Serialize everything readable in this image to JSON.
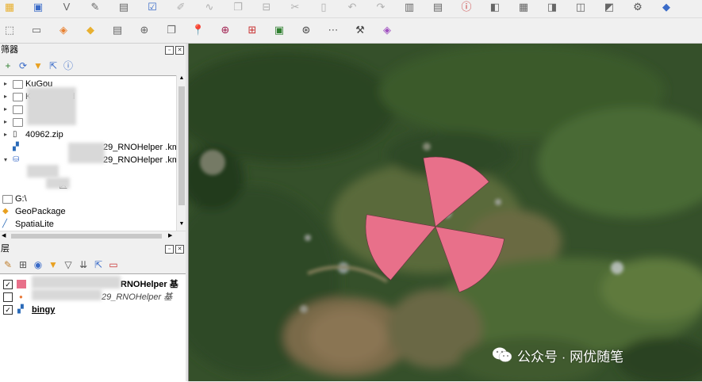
{
  "toolbar_top": {
    "icons": [
      "new-layer-icon",
      "save-icon",
      "vertex-icon",
      "digitize-icon",
      "edit-icon",
      "select-icon",
      "pencil-icon",
      "curve-icon",
      "copy-icon",
      "label-icon",
      "cut-icon",
      "paste-icon",
      "undo-icon",
      "redo-icon",
      "attribute-icon",
      "field-calc-icon",
      "identify-icon",
      "measure-icon",
      "statistics-icon",
      "tip-icon",
      "map-tips-icon",
      "hide-icon",
      "plugin-icon",
      "python-icon"
    ]
  },
  "toolbar_second": {
    "icons": [
      "select-feature-icon",
      "deselect-icon",
      "select-value-icon",
      "select-location-icon",
      "attribute-table-icon",
      "locate-icon",
      "copy-feature-icon",
      "pin-icon",
      "zoom-in-icon",
      "zoom-selection-icon",
      "zoom-layer-icon",
      "globe-icon",
      "xy-icon",
      "wrench-icon",
      "plugin-cube-icon"
    ]
  },
  "browser_panel": {
    "title": "筛器",
    "tools": [
      "add-icon",
      "refresh-icon",
      "filter-icon",
      "collapse-icon",
      "info-icon"
    ],
    "items": [
      {
        "label": "KuGou",
        "type": "folder",
        "expandable": true
      },
      {
        "label": "KuDownload",
        "type": "folder",
        "expandable": true
      },
      {
        "label": "",
        "type": "folder",
        "expandable": true
      },
      {
        "label": "",
        "type": "folder",
        "expandable": true
      },
      {
        "label": "40962.zip",
        "type": "zip",
        "expandable": true
      },
      {
        "label": "29_RNOHelper .km",
        "type": "kml",
        "expandable": false
      },
      {
        "label": "29_RNOHelper .km",
        "type": "db",
        "expandable": true
      },
      {
        "label": "",
        "type": "blank",
        "expandable": false
      },
      {
        "label": "区",
        "type": "blank",
        "expandable": false
      },
      {
        "label": "G:\\",
        "type": "drive",
        "expandable": false
      },
      {
        "label": "GeoPackage",
        "type": "geopackage",
        "expandable": false
      },
      {
        "label": "SpatiaLite",
        "type": "spatialite",
        "expandable": false
      }
    ]
  },
  "layers_panel": {
    "title": "层",
    "tools": [
      "style-icon",
      "add-group-icon",
      "visibility-icon",
      "filter-icon",
      "filter-legend-icon",
      "expand-icon",
      "collapse-icon",
      "remove-icon"
    ],
    "layers": [
      {
        "label": "RNOHelper 基",
        "checked": true,
        "italic": false,
        "bold": true,
        "color": "#e8708a"
      },
      {
        "label": "29_RNOHelper 基",
        "checked": false,
        "italic": true,
        "bold": false,
        "color": "#e87a3a"
      },
      {
        "label": "bingy",
        "checked": true,
        "italic": false,
        "bold": true,
        "color": "#2a6ab8"
      }
    ]
  },
  "map": {
    "sector_color": "#e8708a",
    "sector_count": 3
  },
  "watermark": {
    "text": "公众号 · 网优随笔"
  }
}
